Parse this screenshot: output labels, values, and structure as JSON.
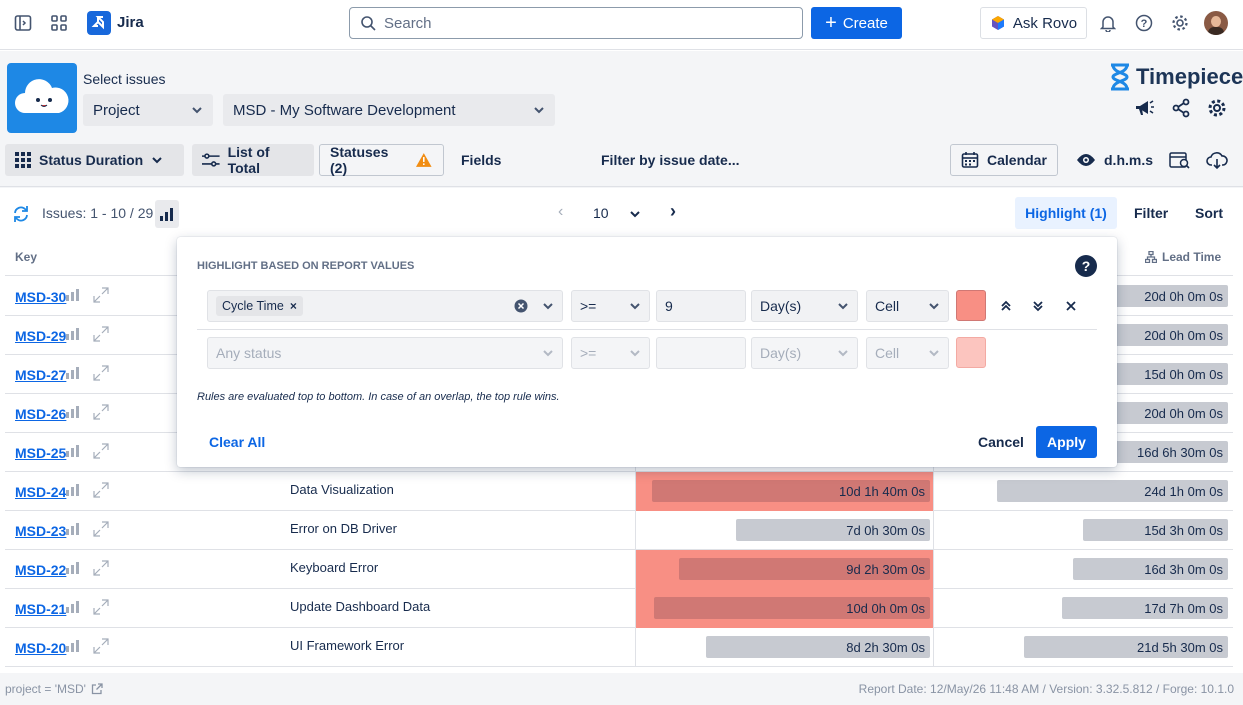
{
  "nav": {
    "app_name": "Jira",
    "search_placeholder": "Search",
    "create_label": "Create",
    "ask_rovo_label": "Ask Rovo"
  },
  "header": {
    "select_issues_label": "Select issues",
    "filter_type": "Project",
    "project_value": "MSD - My Software Development",
    "brand_name": "Timepiece"
  },
  "toolbar": {
    "report_type": "Status Duration",
    "list_of_total": "List of Total",
    "statuses_label": "Statuses (2)",
    "fields_label": "Fields",
    "filter_date_label": "Filter by issue date...",
    "calendar_label": "Calendar",
    "time_format": "d.h.m.s"
  },
  "subbar": {
    "issues_range": "Issues: 1 - 10 / 29",
    "page_size": "10",
    "highlight_label": "Highlight (1)",
    "filter_label": "Filter",
    "sort_label": "Sort"
  },
  "table": {
    "key_header": "Key",
    "lead_time_header": "Lead Time",
    "rows": [
      {
        "key": "MSD-30",
        "summary": "",
        "cycle": "",
        "lead": "20d 0h 0m 0s"
      },
      {
        "key": "MSD-29",
        "summary": "",
        "cycle": "",
        "lead": "20d 0h 0m 0s"
      },
      {
        "key": "MSD-27",
        "summary": "",
        "cycle": "",
        "lead": "15d 0h 0m 0s"
      },
      {
        "key": "MSD-26",
        "summary": "",
        "cycle": "",
        "lead": "20d 0h 0m 0s"
      },
      {
        "key": "MSD-25",
        "summary": "",
        "cycle": "",
        "lead": "16d 6h 30m 0s"
      },
      {
        "key": "MSD-24",
        "summary": "Data Visualization",
        "cycle": "10d 1h 40m 0s",
        "lead": "24d 1h 0m 0s"
      },
      {
        "key": "MSD-23",
        "summary": "Error on DB Driver",
        "cycle": "7d 0h 30m 0s",
        "lead": "15d 3h 0m 0s"
      },
      {
        "key": "MSD-22",
        "summary": "Keyboard Error",
        "cycle": "9d 2h 30m 0s",
        "lead": "16d 3h 0m 0s"
      },
      {
        "key": "MSD-21",
        "summary": "Update Dashboard Data",
        "cycle": "10d 0h 0m 0s",
        "lead": "17d 7h 0m 0s"
      },
      {
        "key": "MSD-20",
        "summary": "UI Framework Error",
        "cycle": "8d 2h 30m 0s",
        "lead": "21d 5h 30m 0s"
      }
    ]
  },
  "highlight_panel": {
    "title": "HIGHLIGHT BASED ON REPORT VALUES",
    "rule1": {
      "field_chip": "Cycle Time",
      "operator": ">=",
      "value": "9",
      "unit": "Day(s)",
      "scope": "Cell",
      "color": "#f88f84"
    },
    "rule2": {
      "field_placeholder": "Any status",
      "operator": ">=",
      "value": "",
      "unit": "Day(s)",
      "scope": "Cell",
      "color": "#fcc5bf"
    },
    "note": "Rules are evaluated top to bottom. In case of an overlap, the top rule wins.",
    "clear_all": "Clear All",
    "cancel": "Cancel",
    "apply": "Apply"
  },
  "footer": {
    "jql": "project = 'MSD'",
    "report_info": "Report Date: 12/May/26 11:48 AM / Version: 3.32.5.812 / Forge: 10.1.0"
  }
}
